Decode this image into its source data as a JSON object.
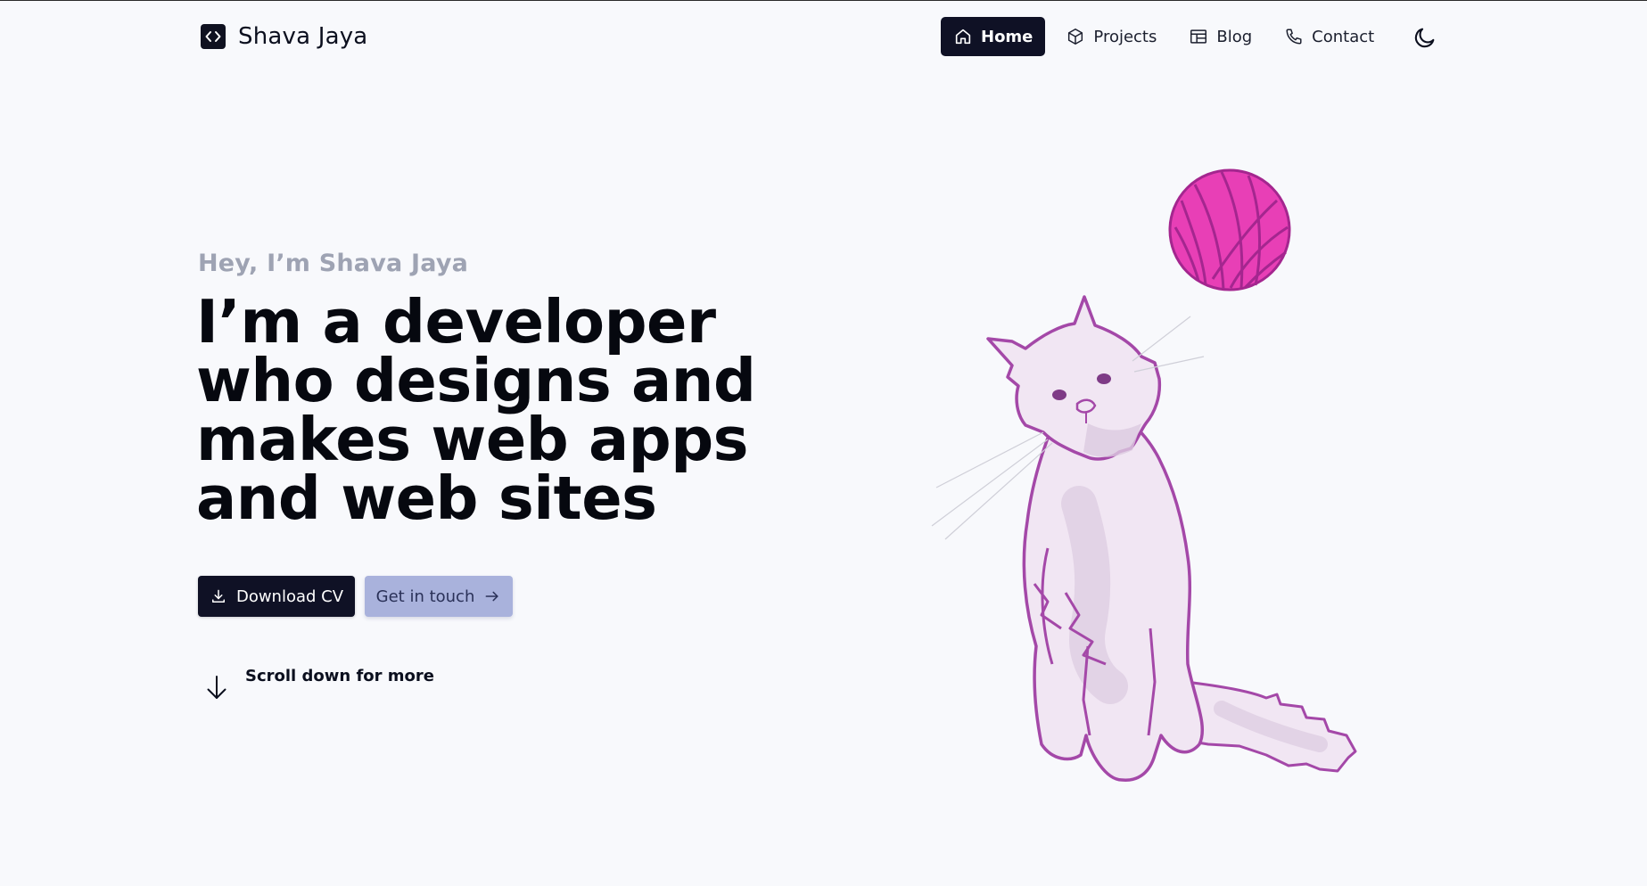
{
  "brand": {
    "name": "Shava Jaya",
    "icon": "code-brackets-icon"
  },
  "nav": {
    "items": [
      {
        "label": "Home",
        "icon": "home-icon",
        "active": true
      },
      {
        "label": "Projects",
        "icon": "cube-icon",
        "active": false
      },
      {
        "label": "Blog",
        "icon": "layout-icon",
        "active": false
      },
      {
        "label": "Contact",
        "icon": "phone-icon",
        "active": false
      }
    ],
    "theme_toggle_icon": "moon-icon"
  },
  "hero": {
    "greeting": "Hey, I’m Shava Jaya",
    "headline": "I’m a developer who designs and makes web apps and web sites",
    "download_label": "Download CV",
    "download_icon": "download-icon",
    "contact_label": "Get in touch",
    "contact_icon": "arrow-right-icon",
    "scroll_text": "Scroll down for more",
    "scroll_icon": "arrow-down-icon"
  },
  "illustration": {
    "subject": "cat-looking-at-yarn-ball",
    "yarn_color": "#e83fb6",
    "outline_color": "#a448a8",
    "fill_color": "#f1e6f3"
  },
  "colors": {
    "accent": "#0f1125",
    "secondary_button": "#a9b2dc",
    "muted_text": "#9ea3b3",
    "background": "#f8f9fc"
  }
}
